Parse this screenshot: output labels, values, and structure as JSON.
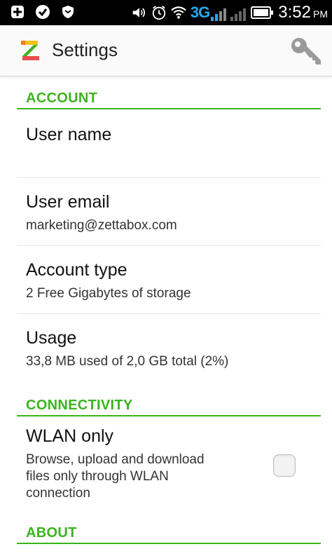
{
  "status_bar": {
    "icons": [
      "add-box-icon",
      "check-circle-icon",
      "shield-icon",
      "volume-icon",
      "alarm-icon",
      "wifi-icon"
    ],
    "network_label": "3G",
    "time": "3:52",
    "ampm": "PM"
  },
  "app_bar": {
    "title": "Settings",
    "logo": "zettabox-logo",
    "action_icon": "key-icon"
  },
  "sections": {
    "account": {
      "header": "ACCOUNT",
      "user_name": {
        "title": "User name",
        "summary": ""
      },
      "user_email": {
        "title": "User email",
        "summary": "marketing@zettabox.com"
      },
      "account_type": {
        "title": "Account type",
        "summary": "2 Free Gigabytes of storage"
      },
      "usage": {
        "title": "Usage",
        "summary": "33,8 MB used of 2,0 GB total (2%)"
      }
    },
    "connectivity": {
      "header": "CONNECTIVITY",
      "wlan_only": {
        "title": "WLAN only",
        "summary_line1": "Browse, upload and download",
        "summary_line2": "files only through WLAN",
        "summary_line3": "connection",
        "checked": false
      }
    },
    "about": {
      "header": "ABOUT"
    }
  },
  "colors": {
    "accent": "#3cb31e",
    "network": "#2ba7e8",
    "status_bar_bg": "#000000"
  }
}
